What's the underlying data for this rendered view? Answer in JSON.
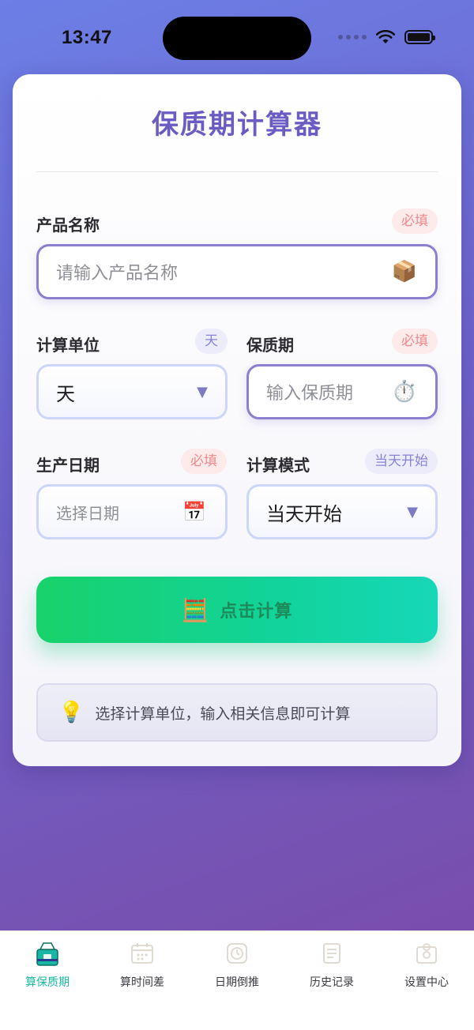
{
  "status_bar": {
    "time": "13:47"
  },
  "card": {
    "title": "保质期计算器",
    "product_name": {
      "label": "产品名称",
      "tag": "必填",
      "placeholder": "请输入产品名称",
      "icon": "package-icon"
    },
    "calc_unit": {
      "label": "计算单位",
      "tag": "天",
      "value": "天"
    },
    "shelf_life": {
      "label": "保质期",
      "tag": "必填",
      "placeholder": "输入保质期",
      "icon": "stopwatch-icon"
    },
    "production_date": {
      "label": "生产日期",
      "tag": "必填",
      "placeholder": "选择日期",
      "icon": "calendar-icon"
    },
    "calc_mode": {
      "label": "计算模式",
      "tag": "当天开始",
      "value": "当天开始"
    },
    "calc_button": {
      "label": "点击计算",
      "icon": "abacus-icon"
    },
    "tip": {
      "text": "选择计算单位，输入相关信息即可计算",
      "icon": "lightbulb-icon"
    }
  },
  "tab_bar": {
    "items": [
      {
        "label": "算保质期",
        "icon": "milk-carton-icon",
        "active": true
      },
      {
        "label": "算时间差",
        "icon": "calendar-grid-icon",
        "active": false
      },
      {
        "label": "日期倒推",
        "icon": "clock-icon",
        "active": false
      },
      {
        "label": "历史记录",
        "icon": "document-icon",
        "active": false
      },
      {
        "label": "设置中心",
        "icon": "settings-icon",
        "active": false
      }
    ]
  },
  "colors": {
    "accent": "#6b5cc4",
    "button_green": "#18d26b",
    "active_tab": "#17b9a6",
    "required_tag": "#ef8a8a"
  }
}
